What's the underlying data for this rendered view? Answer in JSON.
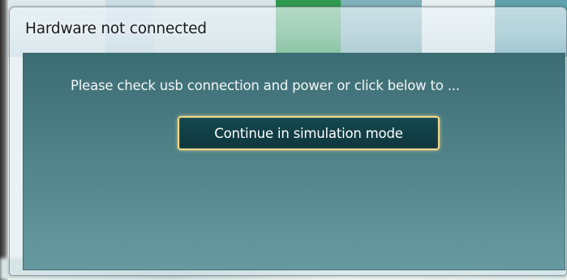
{
  "dialog": {
    "title": "Hardware not connected",
    "message": "Please check usb connection and power or click below to ...",
    "primary_button_label": "Continue in simulation mode"
  },
  "colors": {
    "client_top": "#3c6c74",
    "client_bottom": "#679a9e",
    "button_bg": "#123f46",
    "button_border": "#f2d98a",
    "text": "#f2f6f6"
  }
}
